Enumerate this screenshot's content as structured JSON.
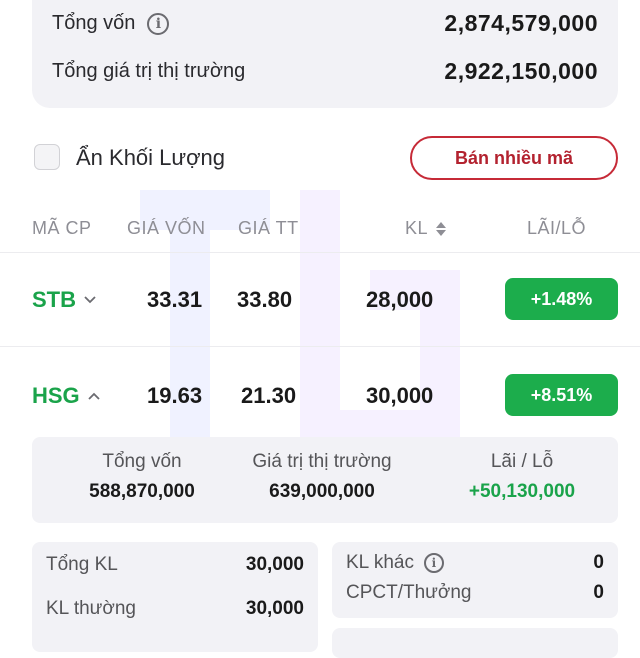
{
  "summary": {
    "total_capital_label": "Tổng vốn",
    "total_capital_value": "2,874,579,000",
    "market_value_label": "Tổng giá trị thị trường",
    "market_value_value": "2,922,150,000"
  },
  "controls": {
    "hide_volume_label": "Ẩn Khối Lượng",
    "sell_multiple_label": "Bán nhiều mã"
  },
  "table": {
    "headers": [
      "MÃ CP",
      "GIÁ VỐN",
      "GIÁ TT",
      "KL",
      "LÃI/LỖ"
    ],
    "rows": [
      {
        "ticker": "STB",
        "cost": "33.31",
        "price": "33.80",
        "volume": "28,000",
        "pl": "+1.48%",
        "expanded": false
      },
      {
        "ticker": "HSG",
        "cost": "19.63",
        "price": "21.30",
        "volume": "30,000",
        "pl": "+8.51%",
        "expanded": true
      }
    ]
  },
  "detail": {
    "capital_label": "Tổng vốn",
    "capital_value": "588,870,000",
    "market_label": "Giá trị thị trường",
    "market_value": "639,000,000",
    "pl_label": "Lãi / Lỗ",
    "pl_value": "+50,130,000",
    "left_box": [
      {
        "label": "Tổng KL",
        "value": "30,000"
      },
      {
        "label": "KL thường",
        "value": "30,000"
      }
    ],
    "right_box": [
      {
        "label": "KL khác",
        "value": "0"
      },
      {
        "label": "CPCT/Thưởng",
        "value": "0"
      }
    ]
  },
  "colors": {
    "positive": "#1cad4c",
    "sell_border": "#c62a37",
    "card_bg": "#f2f2f6"
  },
  "icons": [
    "info-icon",
    "sort-icon",
    "chevron-down-icon",
    "chevron-up-icon"
  ]
}
